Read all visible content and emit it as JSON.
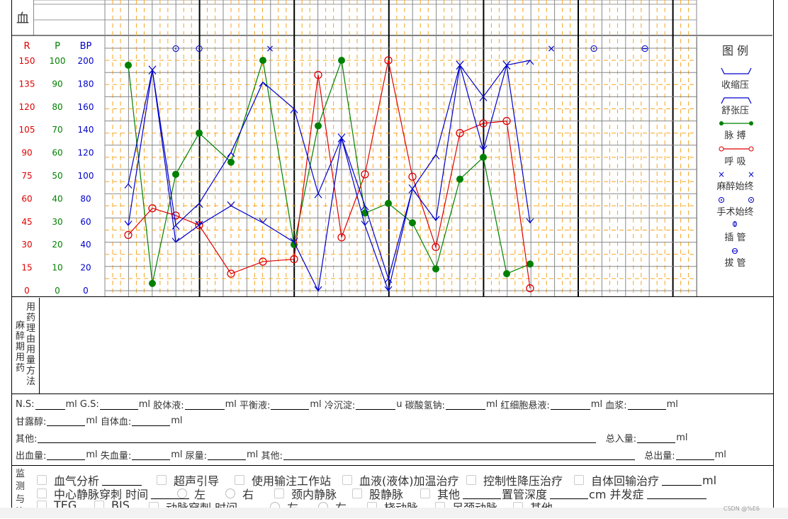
{
  "blood_label": "血",
  "axis_headers": {
    "r": "R",
    "p": "P",
    "bp": "BP"
  },
  "axis_colors": {
    "r": "#e00000",
    "p": "#008000",
    "bp": "#0000cc",
    "grid": "#f5a623"
  },
  "chart_data": {
    "type": "line",
    "x": [
      1,
      2,
      3,
      4,
      5,
      6,
      7,
      8,
      9,
      10,
      11,
      12,
      13,
      14,
      15,
      16,
      17
    ],
    "axes": {
      "r_ticks": [
        "150",
        "135",
        "120",
        "105",
        "90",
        "75",
        "60",
        "45",
        "30",
        "15",
        "0"
      ],
      "p_ticks": [
        "100",
        "90",
        "80",
        "70",
        "60",
        "50",
        "40",
        "30",
        "20",
        "10",
        "0"
      ],
      "bp_ticks": [
        "200",
        "180",
        "160",
        "140",
        "120",
        "100",
        "80",
        "60",
        "40",
        "20",
        "0"
      ]
    },
    "series": [
      {
        "name": "脉 搏",
        "color": "#008000",
        "scale": "P",
        "values": [
          [
            1,
            93
          ],
          [
            2,
            3
          ],
          [
            3,
            48
          ],
          [
            4,
            65
          ],
          [
            5,
            53
          ],
          [
            6,
            95
          ],
          [
            7,
            19
          ],
          [
            8,
            68
          ],
          [
            9,
            95
          ],
          [
            10,
            32
          ],
          [
            11,
            36
          ],
          [
            12,
            28
          ],
          [
            13,
            9
          ],
          [
            14,
            46
          ],
          [
            15,
            55
          ],
          [
            16,
            7
          ],
          [
            17,
            11
          ]
        ]
      },
      {
        "name": "呼 吸",
        "color": "#e00000",
        "scale": "R",
        "values": [
          [
            1,
            23
          ],
          [
            2,
            34
          ],
          [
            3,
            31
          ],
          [
            4,
            27
          ],
          [
            5,
            7
          ],
          [
            6,
            12
          ],
          [
            7,
            13
          ],
          [
            8,
            89
          ],
          [
            9,
            22
          ],
          [
            10,
            48
          ],
          [
            11,
            95
          ],
          [
            12,
            47
          ],
          [
            13,
            18
          ],
          [
            14,
            65
          ],
          [
            15,
            69
          ],
          [
            16,
            70
          ],
          [
            17,
            1
          ]
        ]
      },
      {
        "name": "收缩压",
        "color": "#0000cc",
        "scale": "BP",
        "values": [
          [
            1,
            44
          ],
          [
            2,
            91
          ],
          [
            3,
            27
          ],
          [
            4,
            35
          ],
          [
            5,
            58
          ],
          [
            6,
            86
          ],
          [
            7,
            75
          ],
          [
            8,
            38
          ],
          [
            9,
            63
          ],
          [
            10,
            33
          ],
          [
            11,
            5
          ],
          [
            12,
            42
          ],
          [
            13,
            55
          ],
          [
            14,
            93
          ],
          [
            15,
            80
          ],
          [
            16,
            93
          ],
          [
            17,
            95
          ]
        ]
      },
      {
        "name": "舒张压",
        "color": "#0000cc",
        "scale": "BP",
        "values": [
          [
            1,
            44
          ],
          [
            2,
            91
          ],
          [
            3,
            27
          ],
          [
            4,
            35
          ],
          [
            5,
            58
          ],
          [
            6,
            86
          ],
          [
            7,
            75
          ],
          [
            8,
            38
          ],
          [
            9,
            63
          ],
          [
            10,
            33
          ],
          [
            11,
            5
          ],
          [
            12,
            42
          ],
          [
            13,
            55
          ],
          [
            14,
            93
          ],
          [
            15,
            80
          ],
          [
            16,
            93
          ],
          [
            17,
            95
          ]
        ]
      }
    ],
    "markers": [
      {
        "symbol": "⊙",
        "x": 3
      },
      {
        "symbol": "⊙",
        "x": 4
      },
      {
        "symbol": "×",
        "x": 7
      },
      {
        "symbol": "×",
        "x": 19
      },
      {
        "symbol": "⊙",
        "x": 20
      },
      {
        "symbol": "⊖",
        "x": 22
      }
    ]
  },
  "legend": {
    "title": "图 例",
    "items": [
      "收缩压",
      "舒张压",
      "脉 搏",
      "呼 吸",
      "麻醉始终",
      "手术始终",
      "插 管",
      "拔 管"
    ]
  },
  "medication": {
    "side_label": "麻醉期用药",
    "header_label": "用药理由用量方法"
  },
  "fluids": {
    "row1": [
      {
        "label": "N.S:",
        "unit": "ml"
      },
      {
        "label": "G.S:",
        "unit": "ml"
      },
      {
        "label": "胶体液:",
        "unit": "ml"
      },
      {
        "label": "平衡液:",
        "unit": "ml"
      },
      {
        "label": "冷沉淀:",
        "unit": "u"
      },
      {
        "label": "碳酸氢钠:",
        "unit": "ml"
      },
      {
        "label": "红细胞悬液:",
        "unit": "ml"
      },
      {
        "label": "血浆:",
        "unit": "ml"
      }
    ],
    "row2": [
      {
        "label": "甘露醇:",
        "unit": "ml"
      },
      {
        "label": "自体血:",
        "unit": "ml"
      }
    ],
    "other_label": "其他:",
    "total_in_label": "总入量:",
    "total_in_unit": "ml",
    "row4": [
      {
        "label": "出血量:",
        "unit": "ml"
      },
      {
        "label": "失血量:",
        "unit": "ml"
      },
      {
        "label": "尿量:",
        "unit": "ml"
      }
    ],
    "other2_label": "其他:",
    "total_out_label": "总出量:",
    "total_out_unit": "ml"
  },
  "monitoring": {
    "side_label": "监测与治",
    "row1": [
      "血气分析",
      "超声引导",
      "使用输注工作站",
      "血液(液体)加温治疗",
      "控制性降压治疗",
      "自体回输治疗"
    ],
    "row1_unit": "ml",
    "row2_cvc": "中心静脉穿刺 时间",
    "row2_left": "左",
    "row2_right": "右",
    "row2_items": [
      "颈内静脉",
      "股静脉",
      "其他"
    ],
    "row2_depth": "置管深度",
    "row2_cm": "cm 并发症",
    "row3": [
      "TEG",
      "BIS"
    ],
    "row3_art": "动脉穿刺 时间",
    "row3_left": "左",
    "row3_right": "右",
    "row3_items": [
      "桡动脉",
      "足颈动脉",
      "其他"
    ]
  },
  "watermark": "CSDN @%E6"
}
